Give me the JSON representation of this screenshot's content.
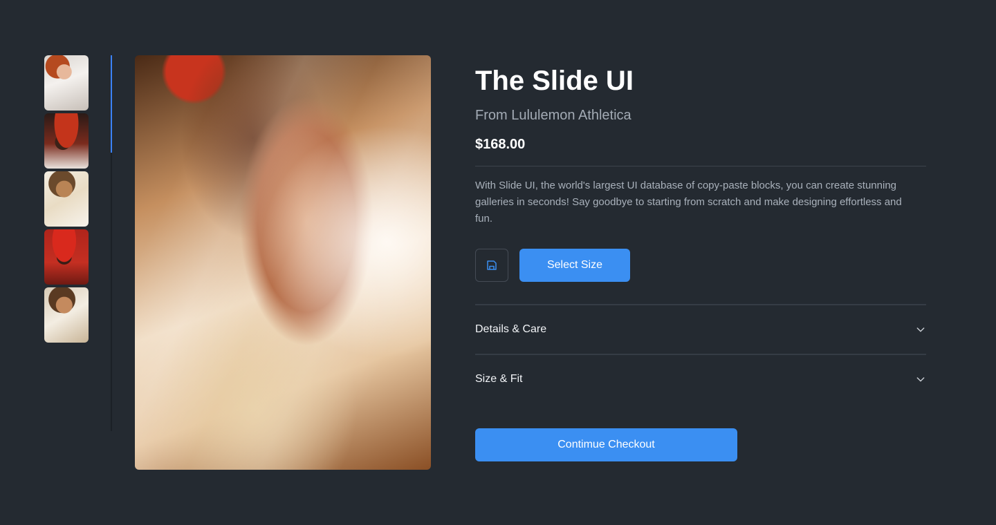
{
  "gallery": {
    "thumbnails": [
      {
        "name": "thumbnail-1",
        "selected": true
      },
      {
        "name": "thumbnail-2",
        "selected": false
      },
      {
        "name": "thumbnail-3",
        "selected": false
      },
      {
        "name": "thumbnail-4",
        "selected": false
      },
      {
        "name": "thumbnail-5",
        "selected": false
      }
    ],
    "scroll_progress": 0.26
  },
  "product": {
    "title": "The Slide UI",
    "brand": "From Lululemon Athletica",
    "price": "$168.00",
    "description": "With Slide UI, the world's largest UI database of copy-paste blocks, you can create stunning galleries in seconds! Say goodbye to starting from scratch and make designing effortless and fun."
  },
  "actions": {
    "save_icon": "floppy-disk-icon",
    "select_size_label": "Select Size",
    "checkout_label": "Contimue Checkout"
  },
  "accordion": [
    {
      "label": "Details & Care",
      "icon": "chevron-down-icon"
    },
    {
      "label": "Size & Fit",
      "icon": "chevron-down-icon"
    }
  ],
  "colors": {
    "background": "#242a31",
    "accent": "#3b8ff2",
    "muted_text": "#a3abb5"
  }
}
